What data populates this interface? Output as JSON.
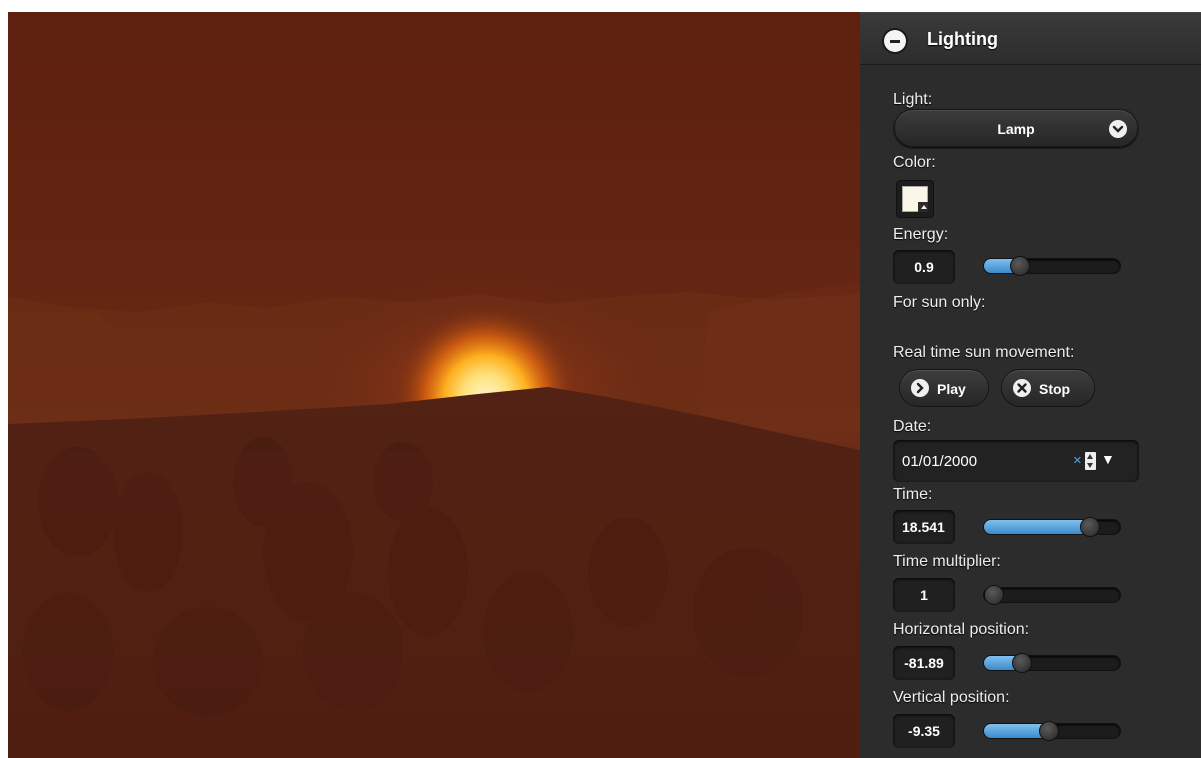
{
  "panel": {
    "title": "Lighting",
    "light_label": "Light:",
    "light_value": "Lamp",
    "color_label": "Color:",
    "color_value": "#fbf7e8",
    "energy_label": "Energy:",
    "energy_value": "0.9",
    "energy_fraction": 0.26,
    "sun_only_label": "For sun only:",
    "realtime_label": "Real time sun movement:",
    "play_label": "Play",
    "stop_label": "Stop",
    "date_label": "Date:",
    "date_value": "01/01/2000",
    "time_label": "Time:",
    "time_value": "18.541",
    "time_fraction": 0.77,
    "multiplier_label": "Time multiplier:",
    "multiplier_value": "1",
    "multiplier_fraction": 0.0,
    "hpos_label": "Horizontal position:",
    "hpos_value": "-81.89",
    "hpos_fraction": 0.27,
    "vpos_label": "Vertical position:",
    "vpos_value": "-9.35",
    "vpos_fraction": 0.47
  },
  "icons": {
    "collapse": "minus-circle-icon",
    "select": "chevron-down-icon",
    "play": "chevron-right-icon",
    "stop": "close-x-icon",
    "date_clear": "x-icon",
    "date_spin": "spinner-icon",
    "date_dropdown": "triangle-down-icon"
  },
  "colors": {
    "accent": "#4a97d6",
    "panel_bg": "#2c2c2c",
    "sky": "#652612",
    "sun": "#fff2b0"
  }
}
